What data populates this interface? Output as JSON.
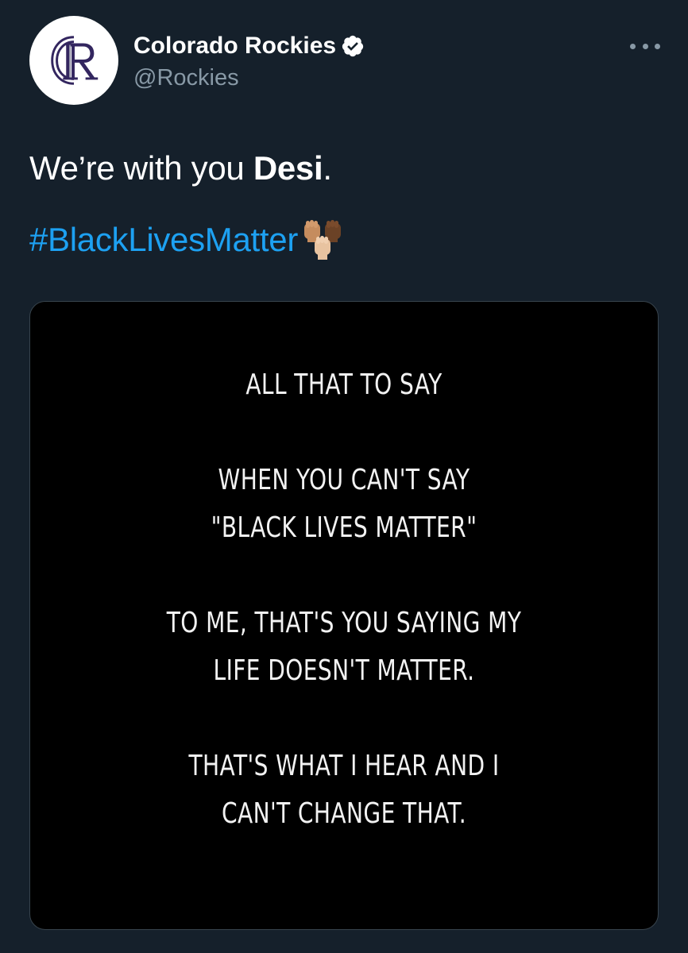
{
  "account": {
    "display_name": "Colorado Rockies",
    "handle": "@Rockies",
    "verified": true,
    "avatar_icon": "rockies-cr-logo-icon"
  },
  "tweet": {
    "text_prefix": "We’re with you ",
    "text_bold": "Desi",
    "text_suffix": ".",
    "hashtag": "#BlackLivesMatter",
    "hashtag_emoji": "raised-fists-icon"
  },
  "media": {
    "lines": [
      "ALL THAT TO SAY",
      "WHEN YOU CAN'T SAY",
      "\"BLACK LIVES MATTER\"",
      "TO ME, THAT'S YOU SAYING MY",
      "LIFE DOESN'T MATTER.",
      "THAT'S WHAT I HEAR AND I",
      "CAN'T CHANGE THAT."
    ]
  },
  "colors": {
    "background": "#15202b",
    "link": "#1da1f2",
    "secondary_text": "#8899a6",
    "media_bg": "#000000"
  }
}
